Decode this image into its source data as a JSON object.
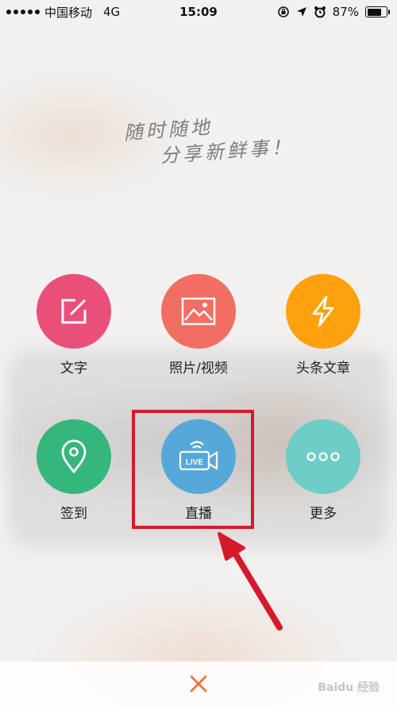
{
  "status_bar": {
    "carrier": "中国移动",
    "network": "4G",
    "time": "15:09",
    "battery": "87%",
    "battery_level": 0.87,
    "icons": [
      "signal-icon",
      "rotation-lock-icon",
      "location-icon",
      "alarm-icon",
      "battery-icon"
    ]
  },
  "slogan": {
    "line1": "随时随地",
    "line2": "分享新鲜事！"
  },
  "actions": [
    {
      "label": "文字",
      "color": "#ea4f7a",
      "icon": "edit-icon"
    },
    {
      "label": "照片/视频",
      "color": "#f26d62",
      "icon": "image-icon"
    },
    {
      "label": "头条文章",
      "color": "#fea10e",
      "icon": "lightning-icon"
    },
    {
      "label": "签到",
      "color": "#35b67c",
      "icon": "location-pin-icon"
    },
    {
      "label": "直播",
      "color": "#56a8d9",
      "icon": "live-camera-icon",
      "icon_text": "LIVE"
    },
    {
      "label": "更多",
      "color": "#6ecdc6",
      "icon": "more-icon"
    }
  ],
  "annotation": {
    "highlight_color": "#d7192c"
  },
  "bottom": {
    "close_icon": "close-icon",
    "close_color": "#f07142"
  },
  "watermark": "Baidu 经验"
}
